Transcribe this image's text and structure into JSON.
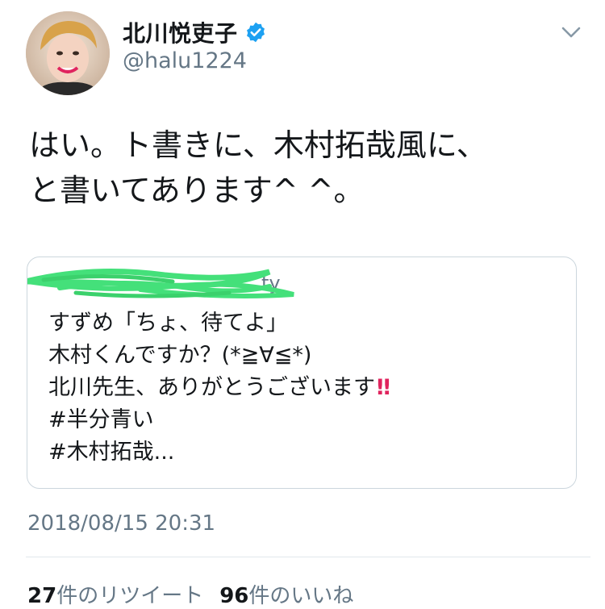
{
  "user": {
    "display_name": "北川悦吏子",
    "handle": "@halu1224",
    "verified": true
  },
  "tweet": {
    "lines": [
      "はい。ト書きに、木村拓哉風に、",
      "と書いてあります^ ^。"
    ]
  },
  "quote": {
    "header": "ty",
    "lines": [
      "すずめ「ちょ、待てよ」",
      "木村くんですか？(*≧∀≦*)",
      "北川先生、ありがとうございます",
      "#半分青い",
      "#木村拓哉..."
    ],
    "emphasis": "‼"
  },
  "timestamp": "2018/08/15 20:31",
  "stats": {
    "retweets_count": "27",
    "retweets_label": "件のリツイート",
    "likes_count": "96",
    "likes_label": "件のいいね"
  },
  "colors": {
    "verified": "#1da1f2",
    "secondary_text": "#657786",
    "scribble": "#44e07a"
  },
  "icons": [
    "verified-badge-icon",
    "chevron-down-icon"
  ]
}
